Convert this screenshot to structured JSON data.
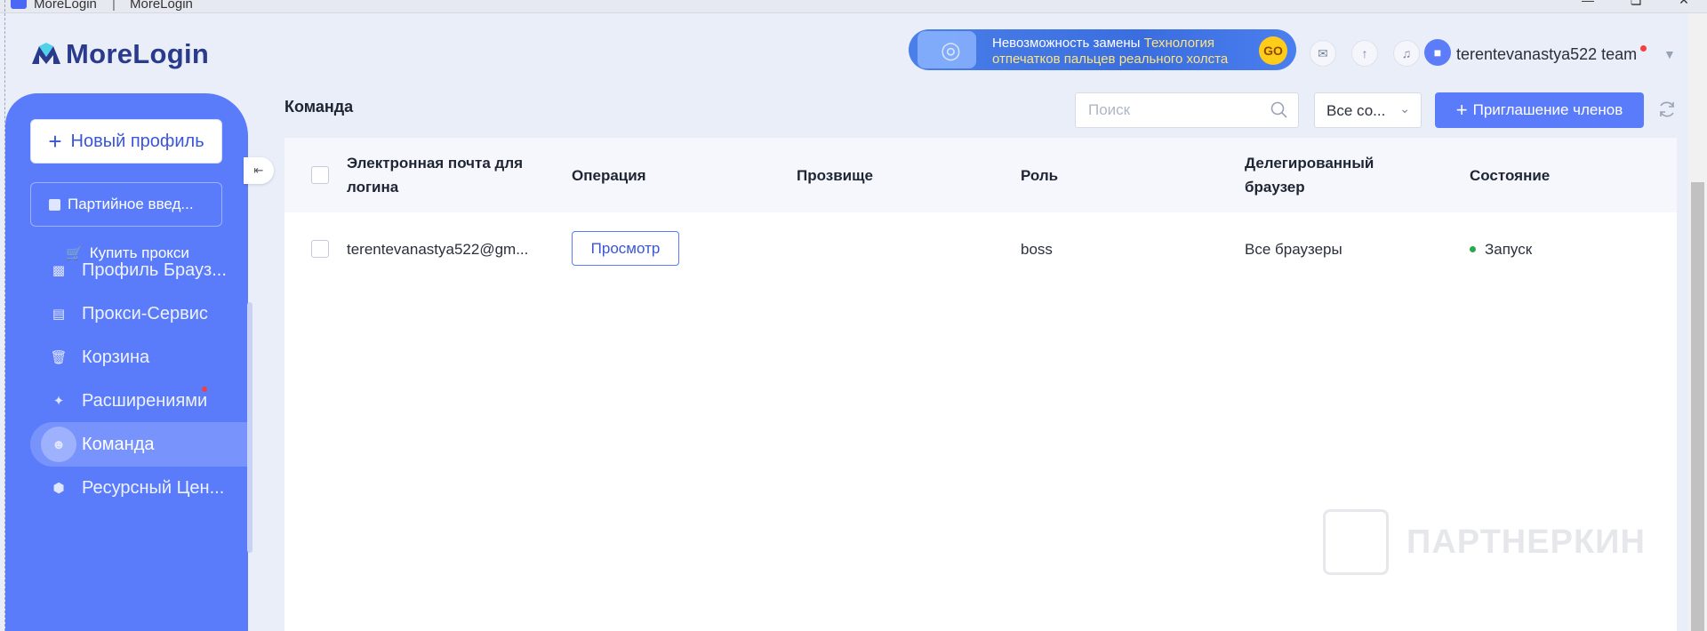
{
  "window": {
    "title_left": "MoreLogin",
    "separator": "|",
    "title_right": "MoreLogin"
  },
  "header": {
    "logo_text": "MoreLogin",
    "banner": {
      "line1_white": "Невозможность замены",
      "line1_yellow": "Технология",
      "line2": "отпечатков пальцев реального холста",
      "go_label": "GO"
    },
    "username": "terentevanastya522 team"
  },
  "sidebar": {
    "new_profile_label": "Новый профиль",
    "batch_import_label": "Партийное введ...",
    "buy_proxy_label": "Купить прокси",
    "items": [
      {
        "label": "Профиль Брауз...",
        "icon": "browser-profile-icon"
      },
      {
        "label": "Прокси-Сервис",
        "icon": "proxy-server-icon"
      },
      {
        "label": "Корзина",
        "icon": "trash-icon"
      },
      {
        "label": "Расширениями",
        "icon": "puzzle-icon"
      },
      {
        "label": "Команда",
        "icon": "team-icon"
      },
      {
        "label": "Ресурсный Цен...",
        "icon": "cube-icon"
      }
    ],
    "active_item": "Команда"
  },
  "main": {
    "page_title": "Команда",
    "search_placeholder": "Поиск",
    "status_select_value": "Все со...",
    "invite_label": "Приглашение членов",
    "table": {
      "columns": [
        "Электронная почта для логина",
        "Операция",
        "Прозвище",
        "Роль",
        "Делегированный браузер",
        "Состояние"
      ],
      "rows": [
        {
          "email": "terentevanastya522@gm...",
          "operation": "Просмотр",
          "nickname": "",
          "role": "boss",
          "browser": "Все браузеры",
          "status": "Запуск"
        }
      ]
    }
  },
  "watermark": "ПАРТНЕРКИН",
  "colors": {
    "accent": "#5b7cfa",
    "status_ok": "#2aa84f",
    "notification": "#f53f3f"
  }
}
